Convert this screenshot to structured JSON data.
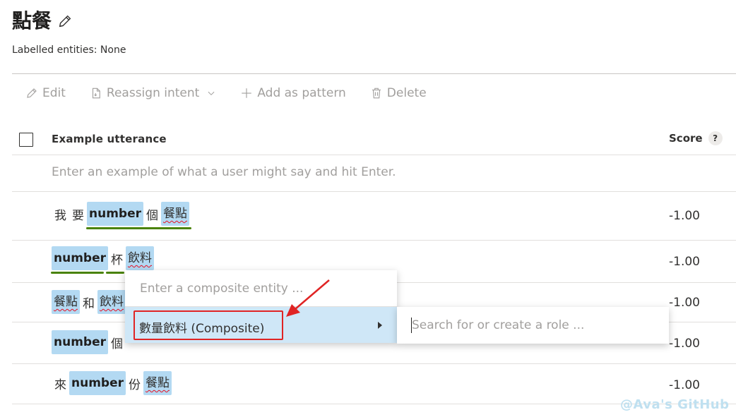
{
  "page": {
    "title": "點餐",
    "labelled_entities": "Labelled entities: None"
  },
  "toolbar": {
    "edit": "Edit",
    "reassign": "Reassign intent",
    "add_pattern": "Add as pattern",
    "delete": "Delete"
  },
  "table": {
    "header_utterance": "Example utterance",
    "header_score": "Score",
    "help": "?",
    "input_placeholder": "Enter an example of what a user might say and hit Enter.",
    "rows": [
      {
        "tokens": [
          "我",
          "要",
          "number",
          "個",
          "餐點"
        ],
        "score": "-1.00"
      },
      {
        "tokens": [
          "number",
          "杯",
          "飲料"
        ],
        "score": "-1.00"
      },
      {
        "tokens": [
          "餐點",
          "和",
          "飲料"
        ],
        "score": "-1.00"
      },
      {
        "tokens": [
          "number",
          "個"
        ],
        "score": "-1.00"
      },
      {
        "tokens": [
          "來",
          "number",
          "份",
          "餐點"
        ],
        "score": "-1.00"
      }
    ]
  },
  "popup": {
    "composite_placeholder": "Enter a composite entity ...",
    "item": "數量飲料 (Composite)",
    "role_placeholder": "Search for or create a role ..."
  },
  "watermark": "@Ava's GitHub",
  "colors": {
    "entity_bg": "#b3d9f2",
    "composite_line": "#498205",
    "highlight": "#cfe7f7",
    "annotation_red": "#e02424"
  }
}
